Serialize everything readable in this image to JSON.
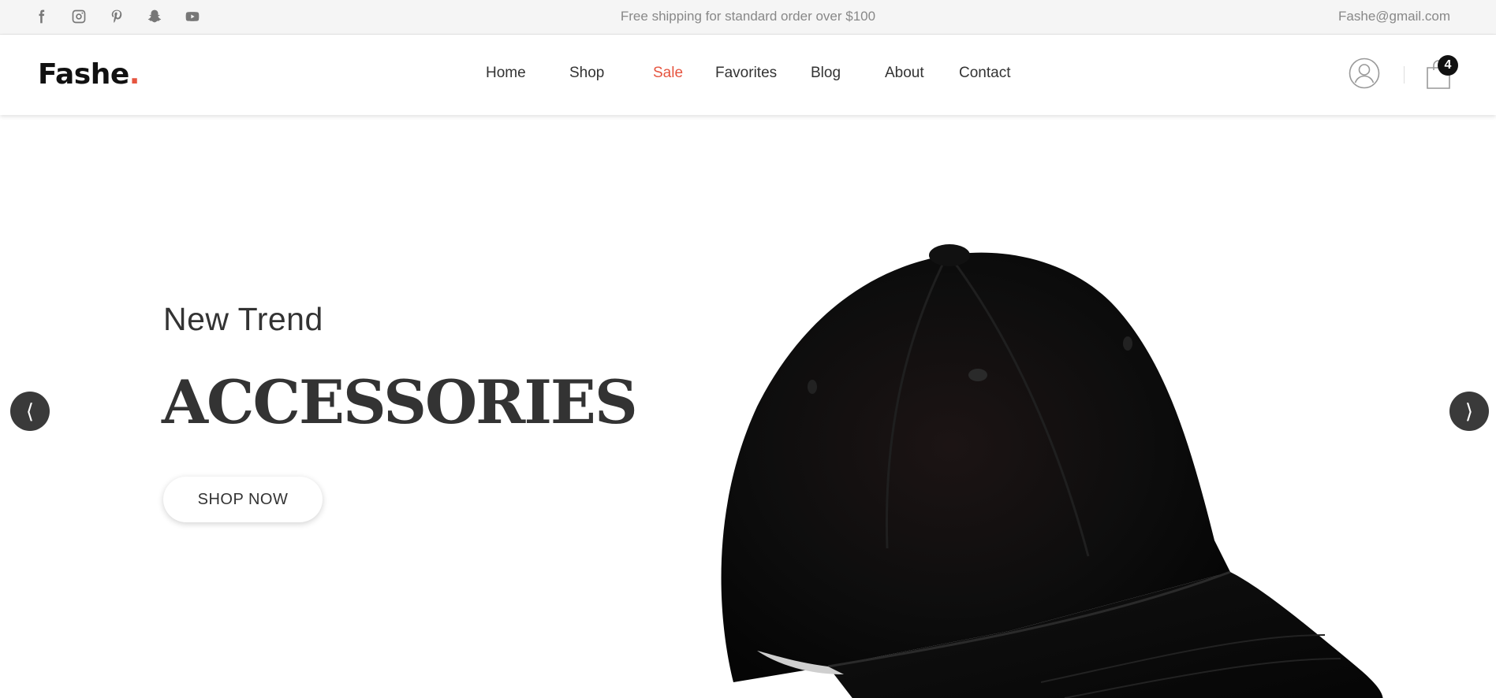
{
  "topbar": {
    "social": [
      "facebook-icon",
      "instagram-icon",
      "pinterest-icon",
      "snapchat-icon",
      "youtube-icon"
    ],
    "shipping_text": "Free shipping for standard order over $100",
    "email": "Fashe@gmail.com"
  },
  "header": {
    "logo": "Fashe",
    "logo_dot": ".",
    "accent_color": "#e65540",
    "nav": [
      "Home",
      "Shop",
      "Sale",
      "Favorites",
      "Blog",
      "About",
      "Contact"
    ],
    "cart_count": "4"
  },
  "hero": {
    "subtitle": "New Trend",
    "title": "ACCESSORIES",
    "button": "SHOP NOW",
    "prev_icon": "chevron-left-icon",
    "next_icon": "chevron-right-icon",
    "image": "black-baseball-cap"
  }
}
